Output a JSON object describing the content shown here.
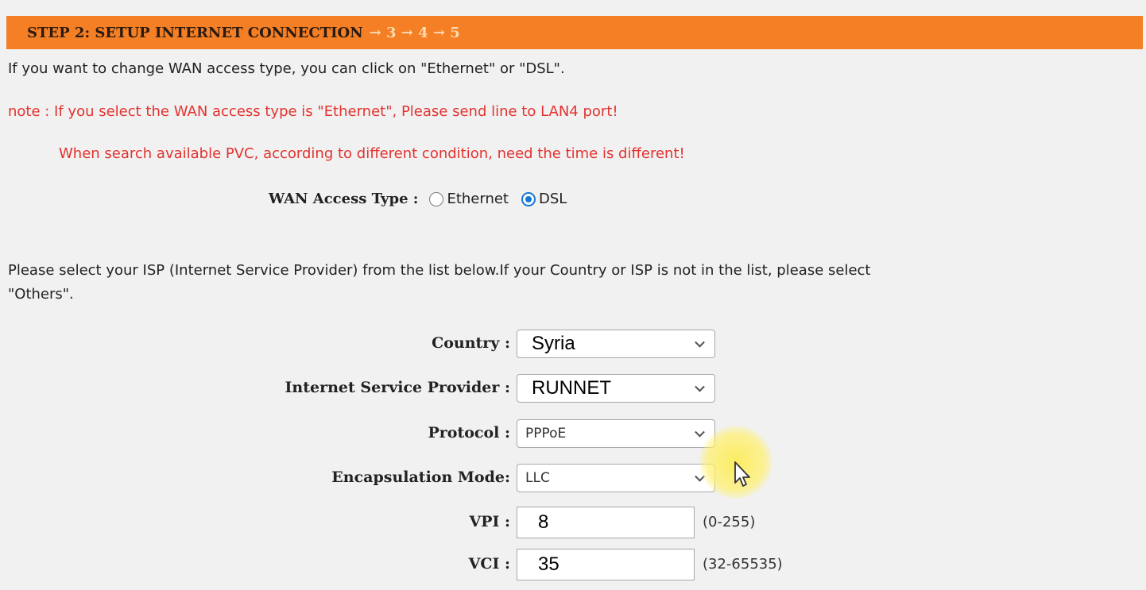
{
  "step_header": {
    "current": "STEP 2: SETUP INTERNET CONNECTION",
    "rest": "→ 3 → 4 → 5"
  },
  "intro": "If you want to change WAN access type, you can click on \"Ethernet\" or \"DSL\".",
  "note_line1": "note : If you select the WAN access type is \"Ethernet\", Please send line to LAN4 port!",
  "note_line2": "When search available PVC, according to different condition, need the time is different!",
  "wan_access": {
    "label": "WAN Access Type :",
    "options": [
      "Ethernet",
      "DSL"
    ],
    "selected": "DSL"
  },
  "isp_instructions_line1": "Please select your ISP (Internet Service Provider) from the list below.If your Country or ISP is not in the list, please select",
  "isp_instructions_line2": "\"Others\".",
  "form": {
    "country": {
      "label": "Country :",
      "value": "Syria"
    },
    "isp": {
      "label": "Internet Service Provider :",
      "value": "RUNNET"
    },
    "protocol": {
      "label": "Protocol :",
      "value": "PPPoE"
    },
    "encapsulation": {
      "label": "Encapsulation Mode:",
      "value": "LLC"
    },
    "vpi": {
      "label": "VPI :",
      "value": "8",
      "range": "(0-255)"
    },
    "vci": {
      "label": "VCI :",
      "value": "35",
      "range": "(32-65535)"
    }
  },
  "colors": {
    "header_bg": "#f47f25",
    "note_red": "#e2332f",
    "radio_blue": "#1577d4"
  }
}
